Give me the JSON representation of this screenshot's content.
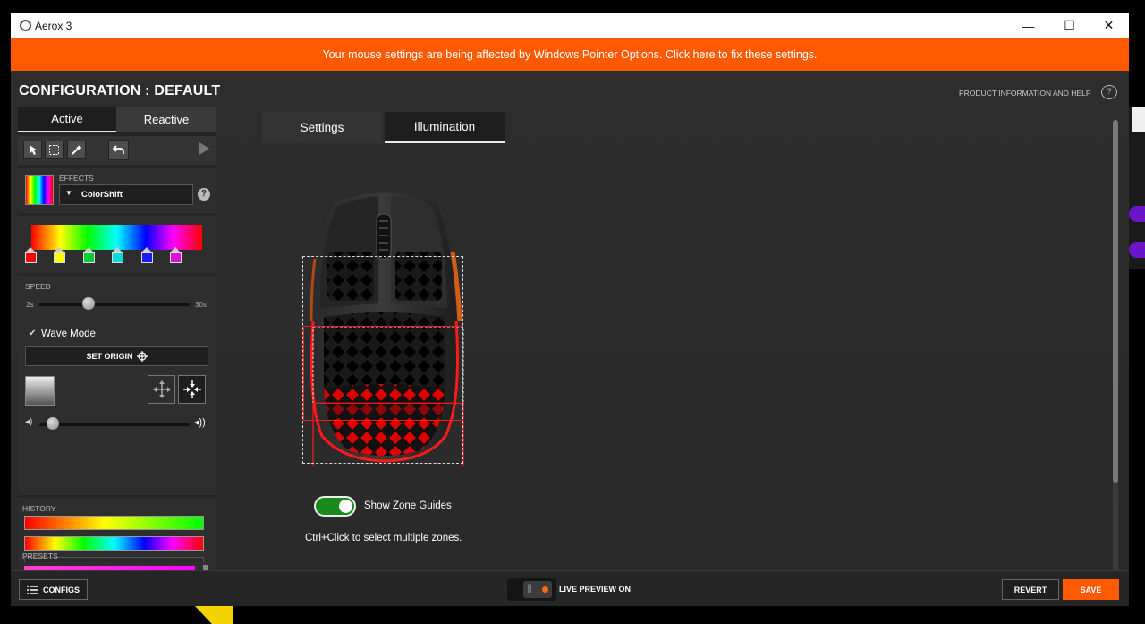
{
  "window": {
    "title": "Aerox 3",
    "minimize_icon": "—",
    "maximize_icon": "☐",
    "close_icon": "✕"
  },
  "banner": {
    "text": "Your mouse settings are being affected by Windows Pointer Options. Click here to fix these settings.",
    "color": "#ff5a00"
  },
  "config": {
    "title": "CONFIGURATION : DEFAULT"
  },
  "help_link": {
    "label": "PRODUCT INFORMATION AND HELP"
  },
  "left_tabs": {
    "active": "Active",
    "reactive": "Reactive"
  },
  "effects": {
    "label": "EFFECTS",
    "selected": "ColorShift",
    "gradient_stops": [
      "#ff0000",
      "#ffff00",
      "#00cc33",
      "#00dddd",
      "#1a1aff",
      "#dd11dd"
    ]
  },
  "speed": {
    "label": "SPEED",
    "min": "2s",
    "max": "30s",
    "value_fraction": 0.33
  },
  "wave_mode": {
    "label": "Wave Mode",
    "checked": true
  },
  "set_origin": {
    "label": "SET ORIGIN"
  },
  "volume": {
    "value_fraction": 0.09
  },
  "history": {
    "label": "HISTORY"
  },
  "presets": {
    "label": "PRESETS"
  },
  "main_tabs": {
    "settings": "Settings",
    "illumination": "Illumination",
    "selected": "Illumination"
  },
  "zone_guides": {
    "label": "Show Zone Guides",
    "enabled": true
  },
  "hint": "Ctrl+Click to select multiple zones.",
  "bottom": {
    "configs": "CONFIGS",
    "live_preview": "LIVE PREVIEW ON",
    "revert": "REVERT",
    "save": "SAVE"
  },
  "colors": {
    "accent": "#ff5a00",
    "toggle_on": "#1a8a1a",
    "zone_red": "#e00000"
  }
}
